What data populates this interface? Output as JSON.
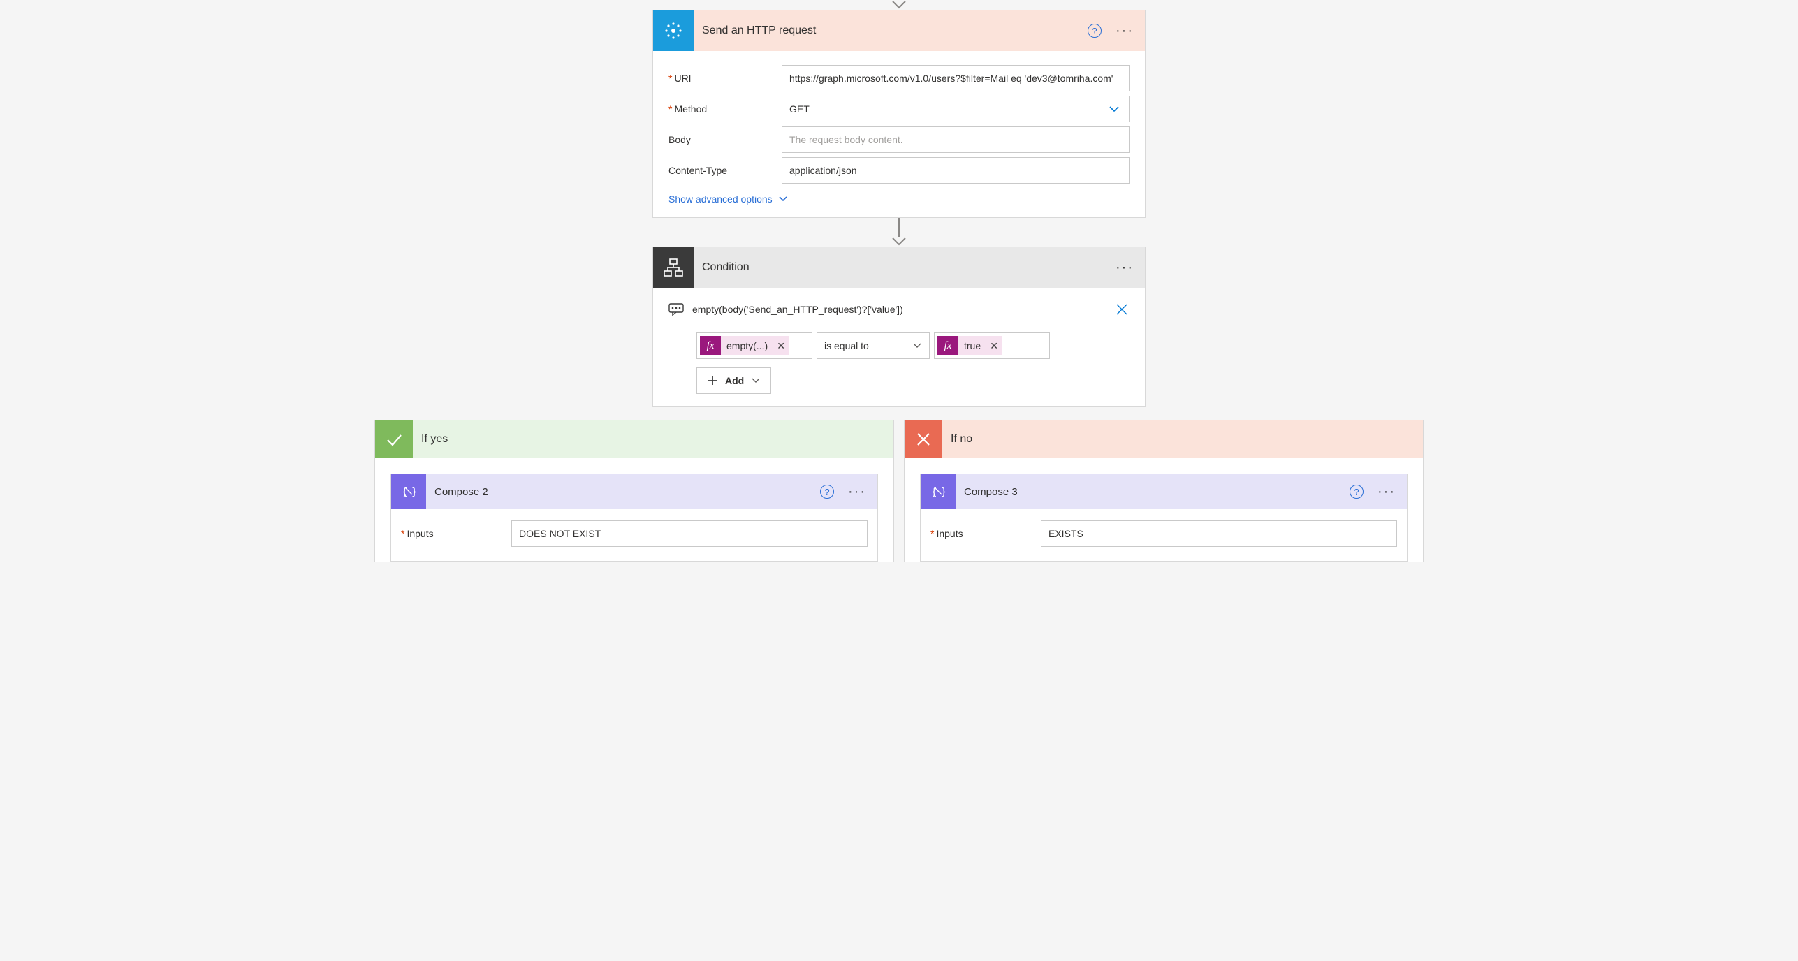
{
  "http": {
    "title": "Send an HTTP request",
    "fields": {
      "uri_label": "URI",
      "uri_value": "https://graph.microsoft.com/v1.0/users?$filter=Mail eq 'dev3@tomriha.com'",
      "method_label": "Method",
      "method_value": "GET",
      "body_label": "Body",
      "body_placeholder": "The request body content.",
      "ct_label": "Content-Type",
      "ct_value": "application/json"
    },
    "advanced": "Show advanced options"
  },
  "condition": {
    "title": "Condition",
    "expression": "empty(body('Send_an_HTTP_request')?['value'])",
    "left_token": "empty(...)",
    "operator": "is equal to",
    "right_token": "true",
    "add_label": "Add",
    "fx": "fx"
  },
  "branches": {
    "yes_title": "If yes",
    "no_title": "If no"
  },
  "compose2": {
    "title": "Compose 2",
    "inputs_label": "Inputs",
    "inputs_value": "DOES NOT EXIST"
  },
  "compose3": {
    "title": "Compose 3",
    "inputs_label": "Inputs",
    "inputs_value": "EXISTS"
  }
}
